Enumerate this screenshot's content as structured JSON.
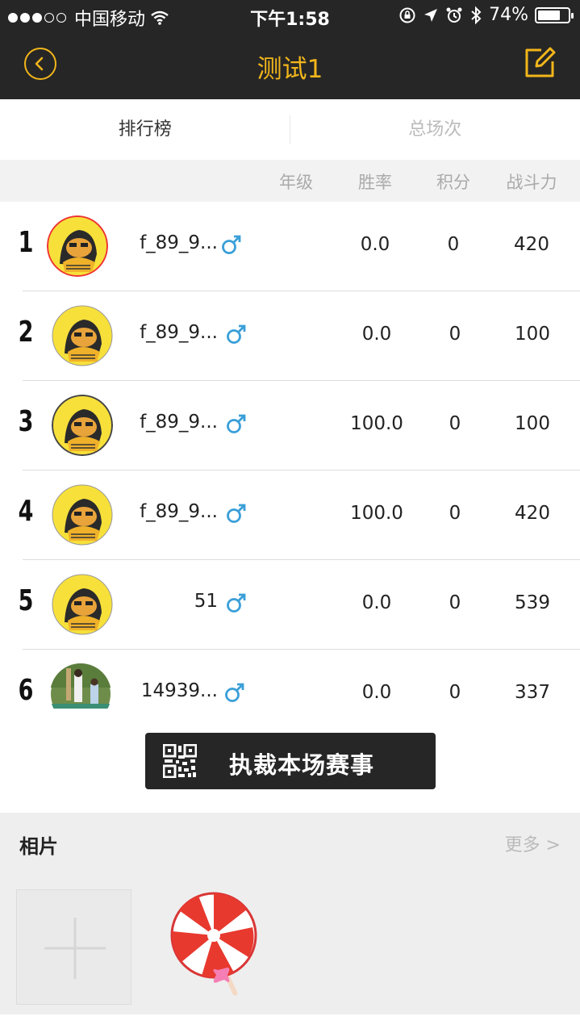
{
  "status_bar": {
    "carrier": "中国移动",
    "time": "下午1:58",
    "battery_percent": "74%",
    "battery_level": 0.74
  },
  "nav": {
    "title": "测试1",
    "back_icon": "back-arrow-circle-icon",
    "edit_icon": "edit-icon"
  },
  "tabs": [
    {
      "label": "排行榜",
      "active": true
    },
    {
      "label": "总场次",
      "active": false
    }
  ],
  "columns": {
    "grade": "年级",
    "win_rate": "胜率",
    "points": "积分",
    "power": "战斗力"
  },
  "rows": [
    {
      "rank": "1",
      "name": "f_89_9...",
      "gender": "male",
      "win_rate": "0.0",
      "points": "0",
      "power": "420"
    },
    {
      "rank": "2",
      "name": "f_89_9...",
      "gender": "male",
      "win_rate": "0.0",
      "points": "0",
      "power": "100"
    },
    {
      "rank": "3",
      "name": "f_89_9...",
      "gender": "male",
      "win_rate": "100.0",
      "points": "0",
      "power": "100"
    },
    {
      "rank": "4",
      "name": "f_89_9...",
      "gender": "male",
      "win_rate": "100.0",
      "points": "0",
      "power": "420"
    },
    {
      "rank": "5",
      "name": "51",
      "gender": "male",
      "win_rate": "0.0",
      "points": "0",
      "power": "539"
    },
    {
      "rank": "6",
      "name": "14939...",
      "gender": "male",
      "win_rate": "0.0",
      "points": "0",
      "power": "337"
    }
  ],
  "judge_button": {
    "label": "执裁本场赛事",
    "icon": "qr-code-icon"
  },
  "photos": {
    "title": "相片",
    "more": "更多 >",
    "add_icon": "plus-icon",
    "items": [
      {
        "icon": "lollipop-icon"
      }
    ]
  },
  "colors": {
    "accent": "#f2b61b",
    "nav_bg": "#262626",
    "male": "#3a9fd8"
  }
}
